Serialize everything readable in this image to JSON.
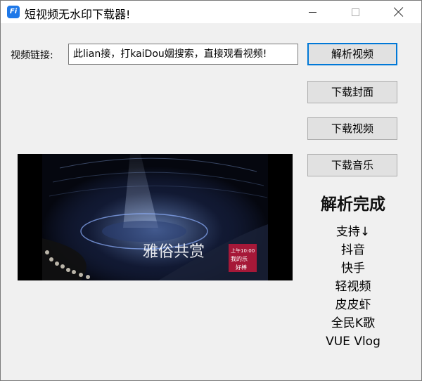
{
  "window": {
    "title": "短视频无水印下载器!",
    "app_icon": "Fi",
    "controls": [
      "minimize-icon",
      "maximize-icon",
      "close-icon"
    ]
  },
  "form": {
    "url_label": "视频链接:",
    "url_value": "此lian接，打kaiDou姻搜索，直接观看视频!"
  },
  "buttons": {
    "parse": "解析视频",
    "download_cover": "下载封面",
    "download_video": "下载视频",
    "download_music": "下载音乐"
  },
  "preview": {
    "caption": "雅俗共赏",
    "badge_top": "上午10:00",
    "badge_mid": "我的乐",
    "badge_bottom": "好棒"
  },
  "status": "解析完成",
  "supported": {
    "heading": "支持↓",
    "items": [
      "抖音",
      "快手",
      "轻视频",
      "皮皮虾",
      "全民K歌",
      "VUE Vlog"
    ]
  },
  "colors": {
    "accent": "#0078d7",
    "window_bg": "#f0f0f0",
    "button_bg": "#e1e1e1",
    "app_icon": "#1e78e8"
  }
}
